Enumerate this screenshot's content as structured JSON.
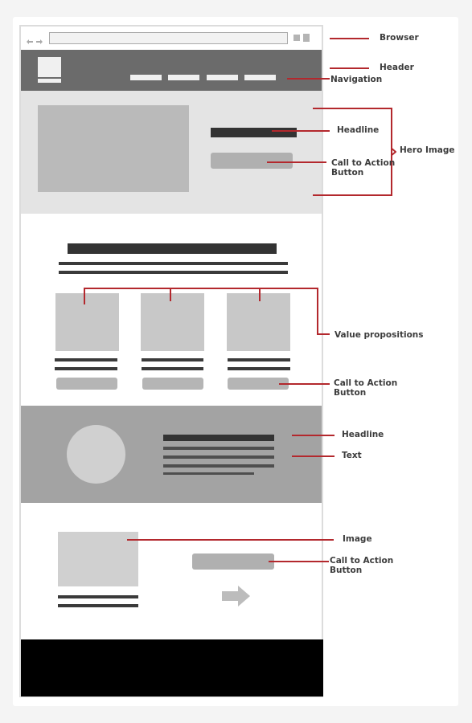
{
  "annotations": {
    "browser": "Browser",
    "header": "Header",
    "navigation": "Navigation",
    "hero_headline": "Headline",
    "hero_cta": "Call to Action\nButton",
    "hero_image": "Hero Image",
    "value_propositions": "Value propositions",
    "value_cta": "Call to Action\nButton",
    "feature_headline": "Headline",
    "feature_text": "Text",
    "image": "Image",
    "bottom_cta": "Call to Action\nButton"
  },
  "colors": {
    "annotation_line": "#b3282d",
    "header_bg": "#6b6b6b",
    "hero_bg": "#e4e4e4",
    "feature_bg": "#a3a3a3",
    "footer_bg": "#000000"
  },
  "wireframe": {
    "nav_item_count": 4,
    "value_proposition_count": 3
  }
}
